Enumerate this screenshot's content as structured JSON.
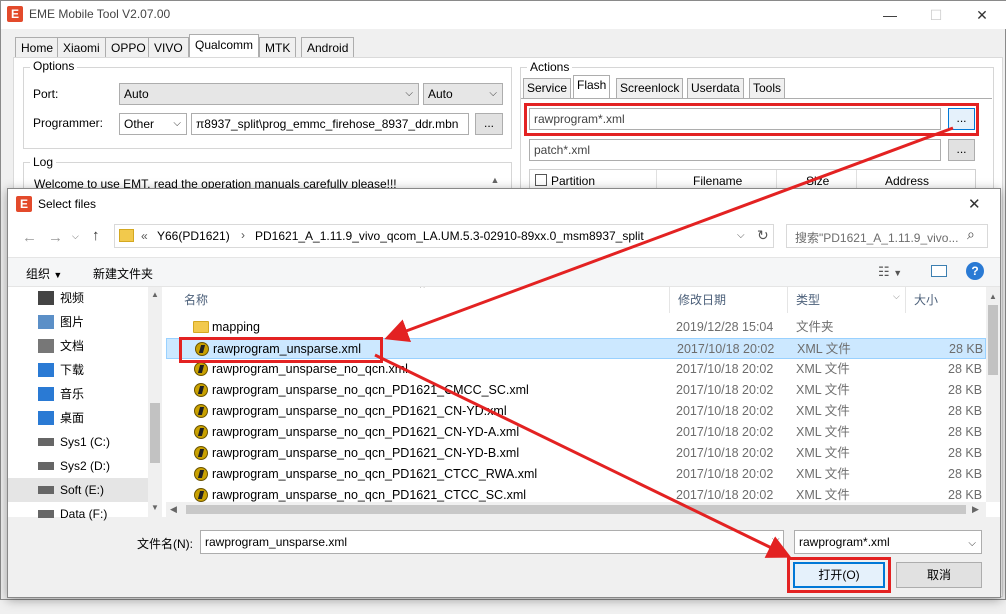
{
  "app": {
    "title": "EME Mobile Tool V2.07.00",
    "tabs": [
      "Home",
      "Xiaomi",
      "OPPO",
      "VIVO",
      "Qualcomm",
      "MTK",
      "Android"
    ],
    "active_tab": "Qualcomm"
  },
  "options": {
    "title": "Options",
    "port_label": "Port:",
    "port_value": "Auto",
    "port_mode": "Auto",
    "programmer_label": "Programmer:",
    "programmer_type": "Other",
    "programmer_path": "π8937_split\\prog_emmc_firehose_8937_ddr.mbn",
    "browse": "..."
  },
  "log": {
    "title": "Log",
    "message": "Welcome to use EMT, read the operation manuals carefully please!!!"
  },
  "actions": {
    "title": "Actions",
    "tabs": [
      "Service",
      "Flash",
      "Screenlock",
      "Userdata",
      "Tools"
    ],
    "active_tab": "Flash",
    "rawprogram_value": "rawprogram*.xml",
    "patch_value": "patch*.xml",
    "browse": "...",
    "table_headers": [
      "Partition",
      "Filename",
      "Size",
      "Address"
    ]
  },
  "dialog": {
    "title": "Select files",
    "breadcrumb_prefix": "«",
    "breadcrumb": [
      "Y66(PD1621)",
      "PD1621_A_1.11.9_vivo_qcom_LA.UM.5.3-02910-89xx.0_msm8937_split"
    ],
    "search_placeholder": "搜索\"PD1621_A_1.11.9_vivo...",
    "toolbar": {
      "organize": "组织",
      "new_folder": "新建文件夹"
    },
    "nav_items": [
      {
        "label": "视频",
        "icon": "video-icon"
      },
      {
        "label": "图片",
        "icon": "picture-icon"
      },
      {
        "label": "文档",
        "icon": "document-icon"
      },
      {
        "label": "下载",
        "icon": "download-icon"
      },
      {
        "label": "音乐",
        "icon": "music-icon"
      },
      {
        "label": "桌面",
        "icon": "desktop-icon"
      },
      {
        "label": "Sys1 (C:)",
        "icon": "drive-icon"
      },
      {
        "label": "Sys2 (D:)",
        "icon": "drive-icon"
      },
      {
        "label": "Soft (E:)",
        "icon": "drive-icon"
      },
      {
        "label": "Data (F:)",
        "icon": "drive-icon"
      }
    ],
    "selected_nav": "Soft (E:)",
    "columns": [
      "名称",
      "修改日期",
      "类型",
      "大小"
    ],
    "files": [
      {
        "name": "mapping",
        "date": "2019/12/28 15:04",
        "type": "文件夹",
        "size": "",
        "kind": "folder"
      },
      {
        "name": "rawprogram_unsparse.xml",
        "date": "2017/10/18 20:02",
        "type": "XML 文件",
        "size": "28 KB",
        "kind": "xml"
      },
      {
        "name": "rawprogram_unsparse_no_qcn.xml",
        "date": "2017/10/18 20:02",
        "type": "XML 文件",
        "size": "28 KB",
        "kind": "xml"
      },
      {
        "name": "rawprogram_unsparse_no_qcn_PD1621_CMCC_SC.xml",
        "date": "2017/10/18 20:02",
        "type": "XML 文件",
        "size": "28 KB",
        "kind": "xml"
      },
      {
        "name": "rawprogram_unsparse_no_qcn_PD1621_CN-YD.xml",
        "date": "2017/10/18 20:02",
        "type": "XML 文件",
        "size": "28 KB",
        "kind": "xml"
      },
      {
        "name": "rawprogram_unsparse_no_qcn_PD1621_CN-YD-A.xml",
        "date": "2017/10/18 20:02",
        "type": "XML 文件",
        "size": "28 KB",
        "kind": "xml"
      },
      {
        "name": "rawprogram_unsparse_no_qcn_PD1621_CN-YD-B.xml",
        "date": "2017/10/18 20:02",
        "type": "XML 文件",
        "size": "28 KB",
        "kind": "xml"
      },
      {
        "name": "rawprogram_unsparse_no_qcn_PD1621_CTCC_RWA.xml",
        "date": "2017/10/18 20:02",
        "type": "XML 文件",
        "size": "28 KB",
        "kind": "xml"
      },
      {
        "name": "rawprogram_unsparse_no_qcn_PD1621_CTCC_SC.xml",
        "date": "2017/10/18 20:02",
        "type": "XML 文件",
        "size": "28 KB",
        "kind": "xml"
      }
    ],
    "selected_file": "rawprogram_unsparse.xml",
    "filename_label": "文件名(N):",
    "filename_value": "rawprogram_unsparse.xml",
    "filter_value": "rawprogram*.xml",
    "open_button": "打开(O)",
    "cancel_button": "取消"
  },
  "colors": {
    "accent": "#e32222",
    "brand": "#e34a2b",
    "selection": "#cce8ff",
    "primary_button_border": "#0078d7"
  }
}
